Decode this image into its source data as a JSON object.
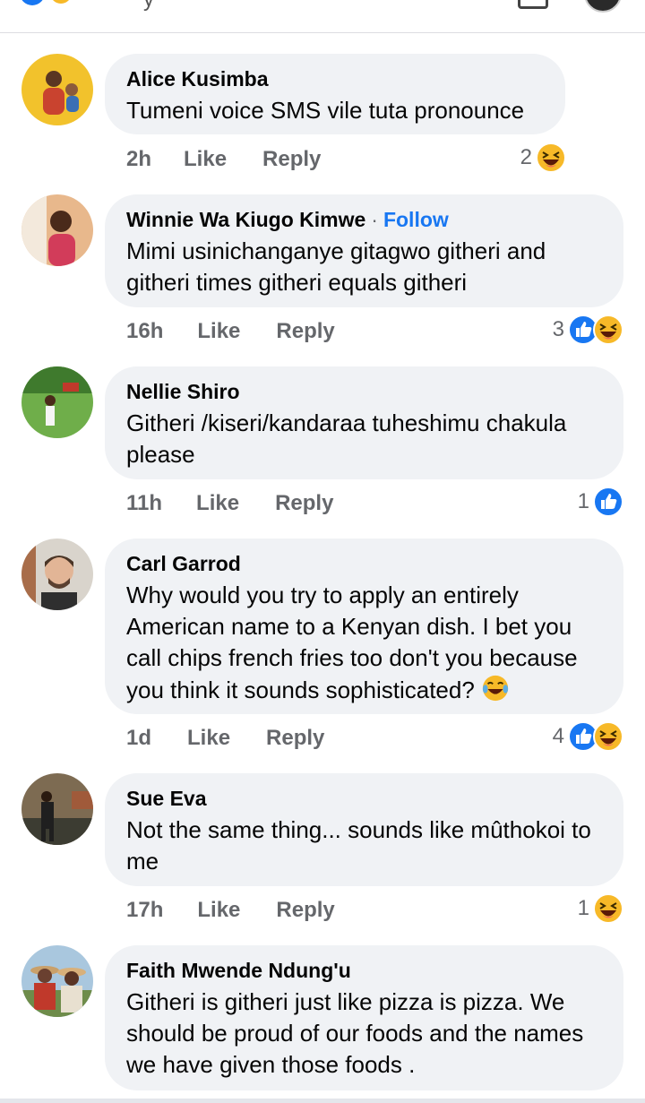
{
  "topbar": {
    "fragment": "y"
  },
  "comments": [
    {
      "author": "Alice Kusimba",
      "follow": "",
      "text": "Tumeni voice SMS vile tuta pronounce",
      "time": "2h",
      "like": "Like",
      "reply": "Reply",
      "reaction_count": "2",
      "reactions": [
        "haha"
      ]
    },
    {
      "author": "Winnie Wa Kiugo Kimwe",
      "follow": "Follow",
      "text": "Mimi usinichanganye gitagwo githeri and githeri times githeri equals githeri",
      "time": "16h",
      "like": "Like",
      "reply": "Reply",
      "reaction_count": "3",
      "reactions": [
        "like",
        "haha"
      ]
    },
    {
      "author": "Nellie Shiro",
      "follow": "",
      "text": "Githeri /kiseri/kandaraa tuheshimu chakula please",
      "time": "11h",
      "like": "Like",
      "reply": "Reply",
      "reaction_count": "1",
      "reactions": [
        "like"
      ]
    },
    {
      "author": "Carl Garrod",
      "follow": "",
      "text": "Why would you try to apply an entirely American name to a Kenyan dish. I bet you call chips french fries too don't you because you think it sounds sophisticated?",
      "inline_emoji": "tears-of-joy",
      "time": "1d",
      "like": "Like",
      "reply": "Reply",
      "reaction_count": "4",
      "reactions": [
        "like",
        "haha"
      ]
    },
    {
      "author": "Sue Eva",
      "follow": "",
      "text": "Not the same thing... sounds like mûthokoi to me",
      "time": "17h",
      "like": "Like",
      "reply": "Reply",
      "reaction_count": "1",
      "reactions": [
        "haha"
      ]
    },
    {
      "author": "Faith Mwende Ndung'u",
      "follow": "",
      "text": "Githeri is githeri just like pizza is pizza. We should be proud of our foods and the names we have given those foods .",
      "time": "",
      "like": "",
      "reply": "",
      "reaction_count": "",
      "reactions": []
    }
  ],
  "colors": {
    "link": "#1877f2",
    "bubble": "#f0f2f5",
    "meta": "#65676b",
    "haha": "#f7b928"
  }
}
